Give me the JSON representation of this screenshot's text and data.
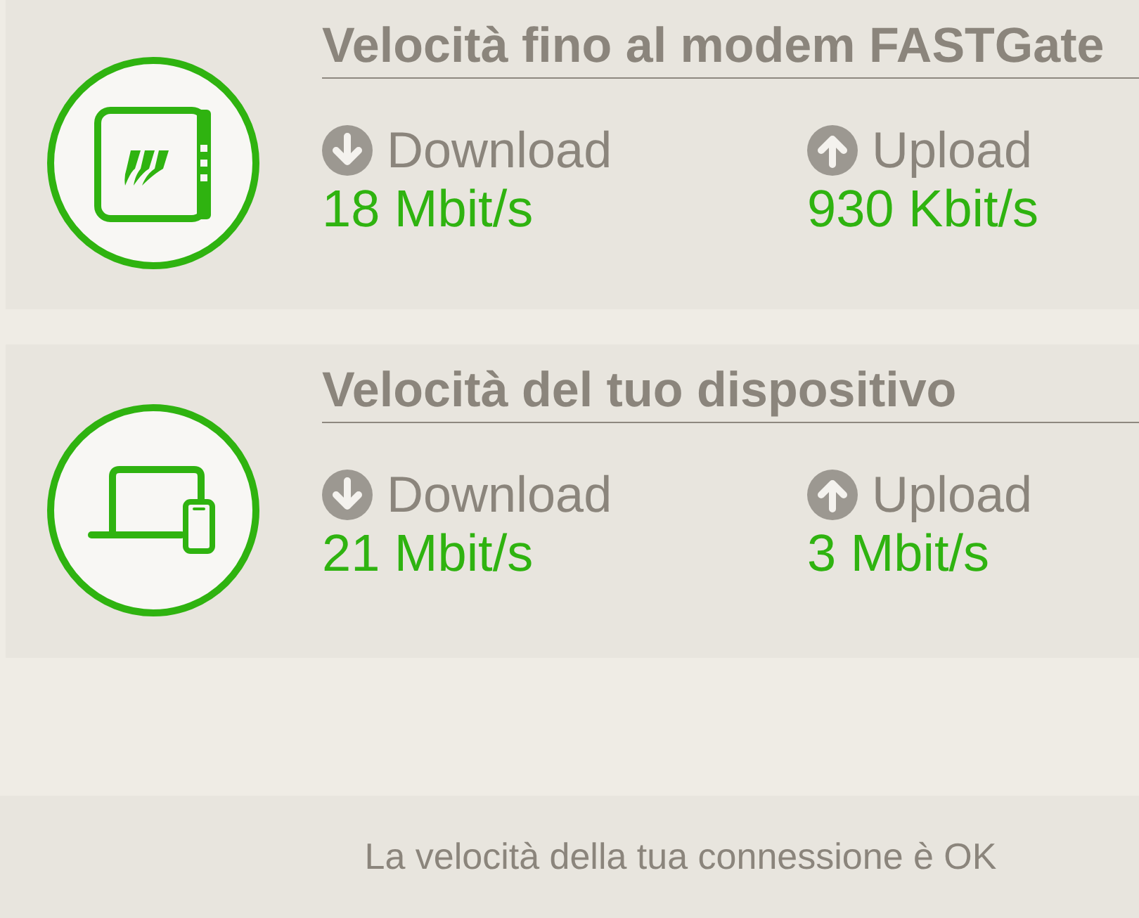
{
  "cards": [
    {
      "kind": "modem",
      "title": "Velocità fino al modem FASTGate",
      "metrics": [
        {
          "kind": "download",
          "label": "Download",
          "value": "18 Mbit/s"
        },
        {
          "kind": "upload",
          "label": "Upload",
          "value": "930 Kbit/s"
        }
      ]
    },
    {
      "kind": "devices",
      "title": "Velocità del tuo dispositivo",
      "metrics": [
        {
          "kind": "download",
          "label": "Download",
          "value": "21 Mbit/s"
        },
        {
          "kind": "upload",
          "label": "Upload",
          "value": "3 Mbit/s"
        }
      ]
    }
  ],
  "status_bar": {
    "message": "La velocità della tua connessione è OK"
  }
}
